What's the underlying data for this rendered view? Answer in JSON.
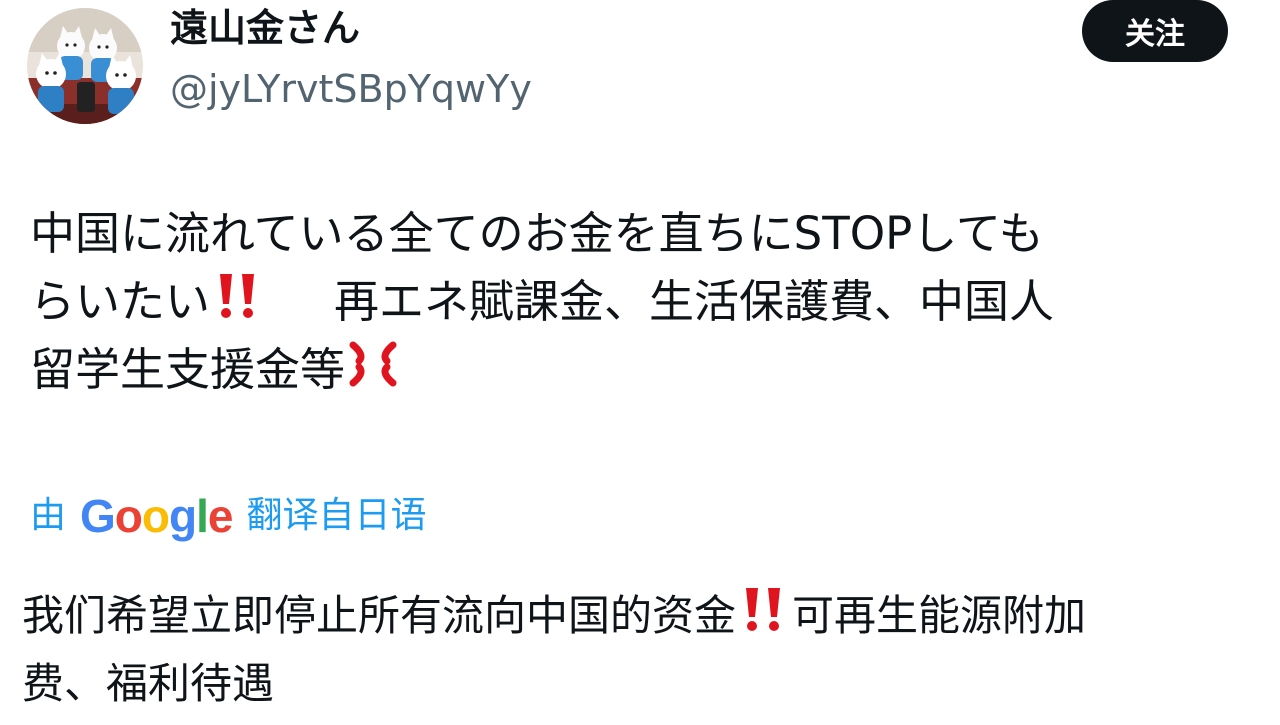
{
  "author": {
    "display_name": "遠山金さん",
    "handle": "@jyLYrvtSBpYqwYy",
    "avatar_icon": "cat-figurines-avatar-icon"
  },
  "follow_button": {
    "label": "关注"
  },
  "tweet": {
    "lines": [
      "中国に流れている全てのお金を直ちにSTOPしても",
      "らいたい",
      "再エネ賦課金、生活保護費、中国人",
      "留学生支援金等"
    ],
    "emoji": {
      "double_exclamation": "double-exclamation-mark-icon",
      "anger": "anger-symbol-icon"
    }
  },
  "translation": {
    "by": "由",
    "provider": "Google",
    "provider_letters": [
      "G",
      "o",
      "o",
      "g",
      "l",
      "e"
    ],
    "provider_colors": [
      "#4285F4",
      "#EA4335",
      "#FBBC05",
      "#4285F4",
      "#34A853",
      "#EA4335"
    ],
    "from": "翻译自日语",
    "lines": [
      "我们希望立即停止所有流向中国的资金",
      "可再生能源附加",
      "费、福利待遇"
    ]
  },
  "colors": {
    "link_blue": "#1d9bf0",
    "text_primary": "#0f1419",
    "text_secondary": "#536471",
    "emoji_red": "#e0141e"
  }
}
